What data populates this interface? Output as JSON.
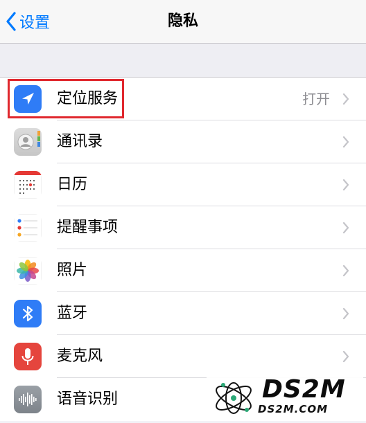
{
  "nav": {
    "back_label": "设置",
    "title": "隐私"
  },
  "rows": [
    {
      "label": "定位服务",
      "value": "打开",
      "icon": "location-arrow-icon"
    },
    {
      "label": "通讯录",
      "value": "",
      "icon": "contacts-icon"
    },
    {
      "label": "日历",
      "value": "",
      "icon": "calendar-icon"
    },
    {
      "label": "提醒事项",
      "value": "",
      "icon": "reminders-icon"
    },
    {
      "label": "照片",
      "value": "",
      "icon": "photos-icon"
    },
    {
      "label": "蓝牙",
      "value": "",
      "icon": "bluetooth-icon"
    },
    {
      "label": "麦克风",
      "value": "",
      "icon": "microphone-icon"
    },
    {
      "label": "语音识别",
      "value": "",
      "icon": "speech-recognition-icon"
    }
  ],
  "watermark": {
    "line1": "DS2M",
    "line2": "DS2M.COM"
  },
  "colors": {
    "accent": "#007aff",
    "highlight_box": "#e0282e"
  }
}
